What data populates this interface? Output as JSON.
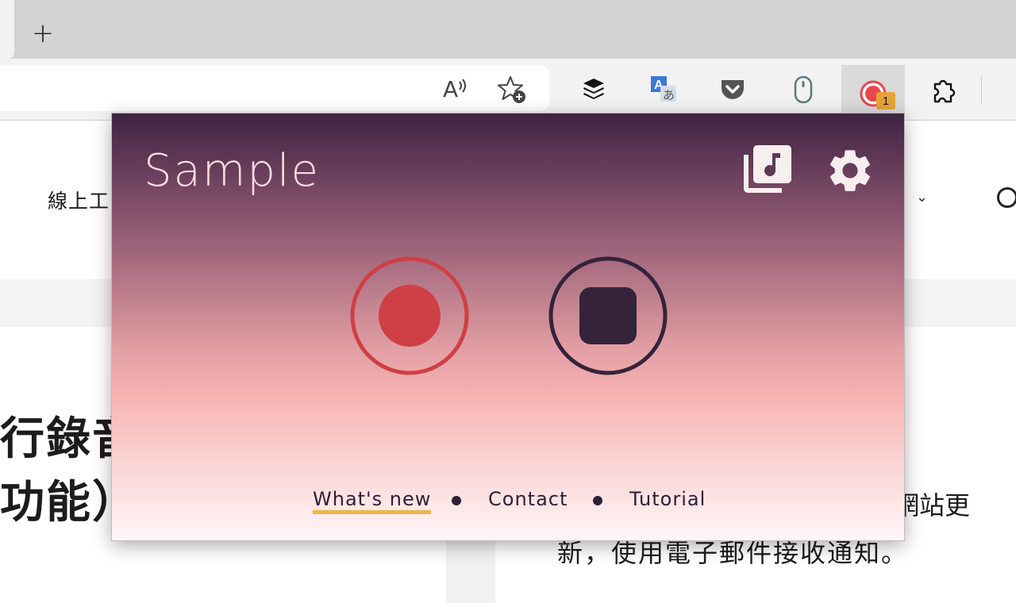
{
  "browser": {
    "new_tab_label": "+",
    "extension_badge_count": "1",
    "toolbar_icons": [
      "read-aloud-icon",
      "add-favorite-icon",
      "buffer-icon",
      "translate-icon",
      "pocket-icon",
      "mouse-icon",
      "screen-recorder-icon",
      "extensions-icon"
    ]
  },
  "page": {
    "nav_text": "線上工",
    "headline_line1": "行錄音",
    "headline_line2": "功能）",
    "paragraph_line1": "網站更",
    "paragraph_line2": "新，使用電子郵件接收通知。"
  },
  "popup": {
    "title": "Sample",
    "library_icon": "music-library-icon",
    "settings_icon": "gear-icon",
    "record_icon": "record-icon",
    "stop_icon": "stop-icon",
    "links": [
      {
        "label": "What's new",
        "active": true
      },
      {
        "label": "Contact",
        "active": false
      },
      {
        "label": "Tutorial",
        "active": false
      }
    ],
    "colors": {
      "record_red": "#cf3f46",
      "stop_dark": "#35233b",
      "active_underline": "#e9b84c",
      "gradient_top": "#3d2342",
      "gradient_bottom": "#fff6f7"
    }
  }
}
